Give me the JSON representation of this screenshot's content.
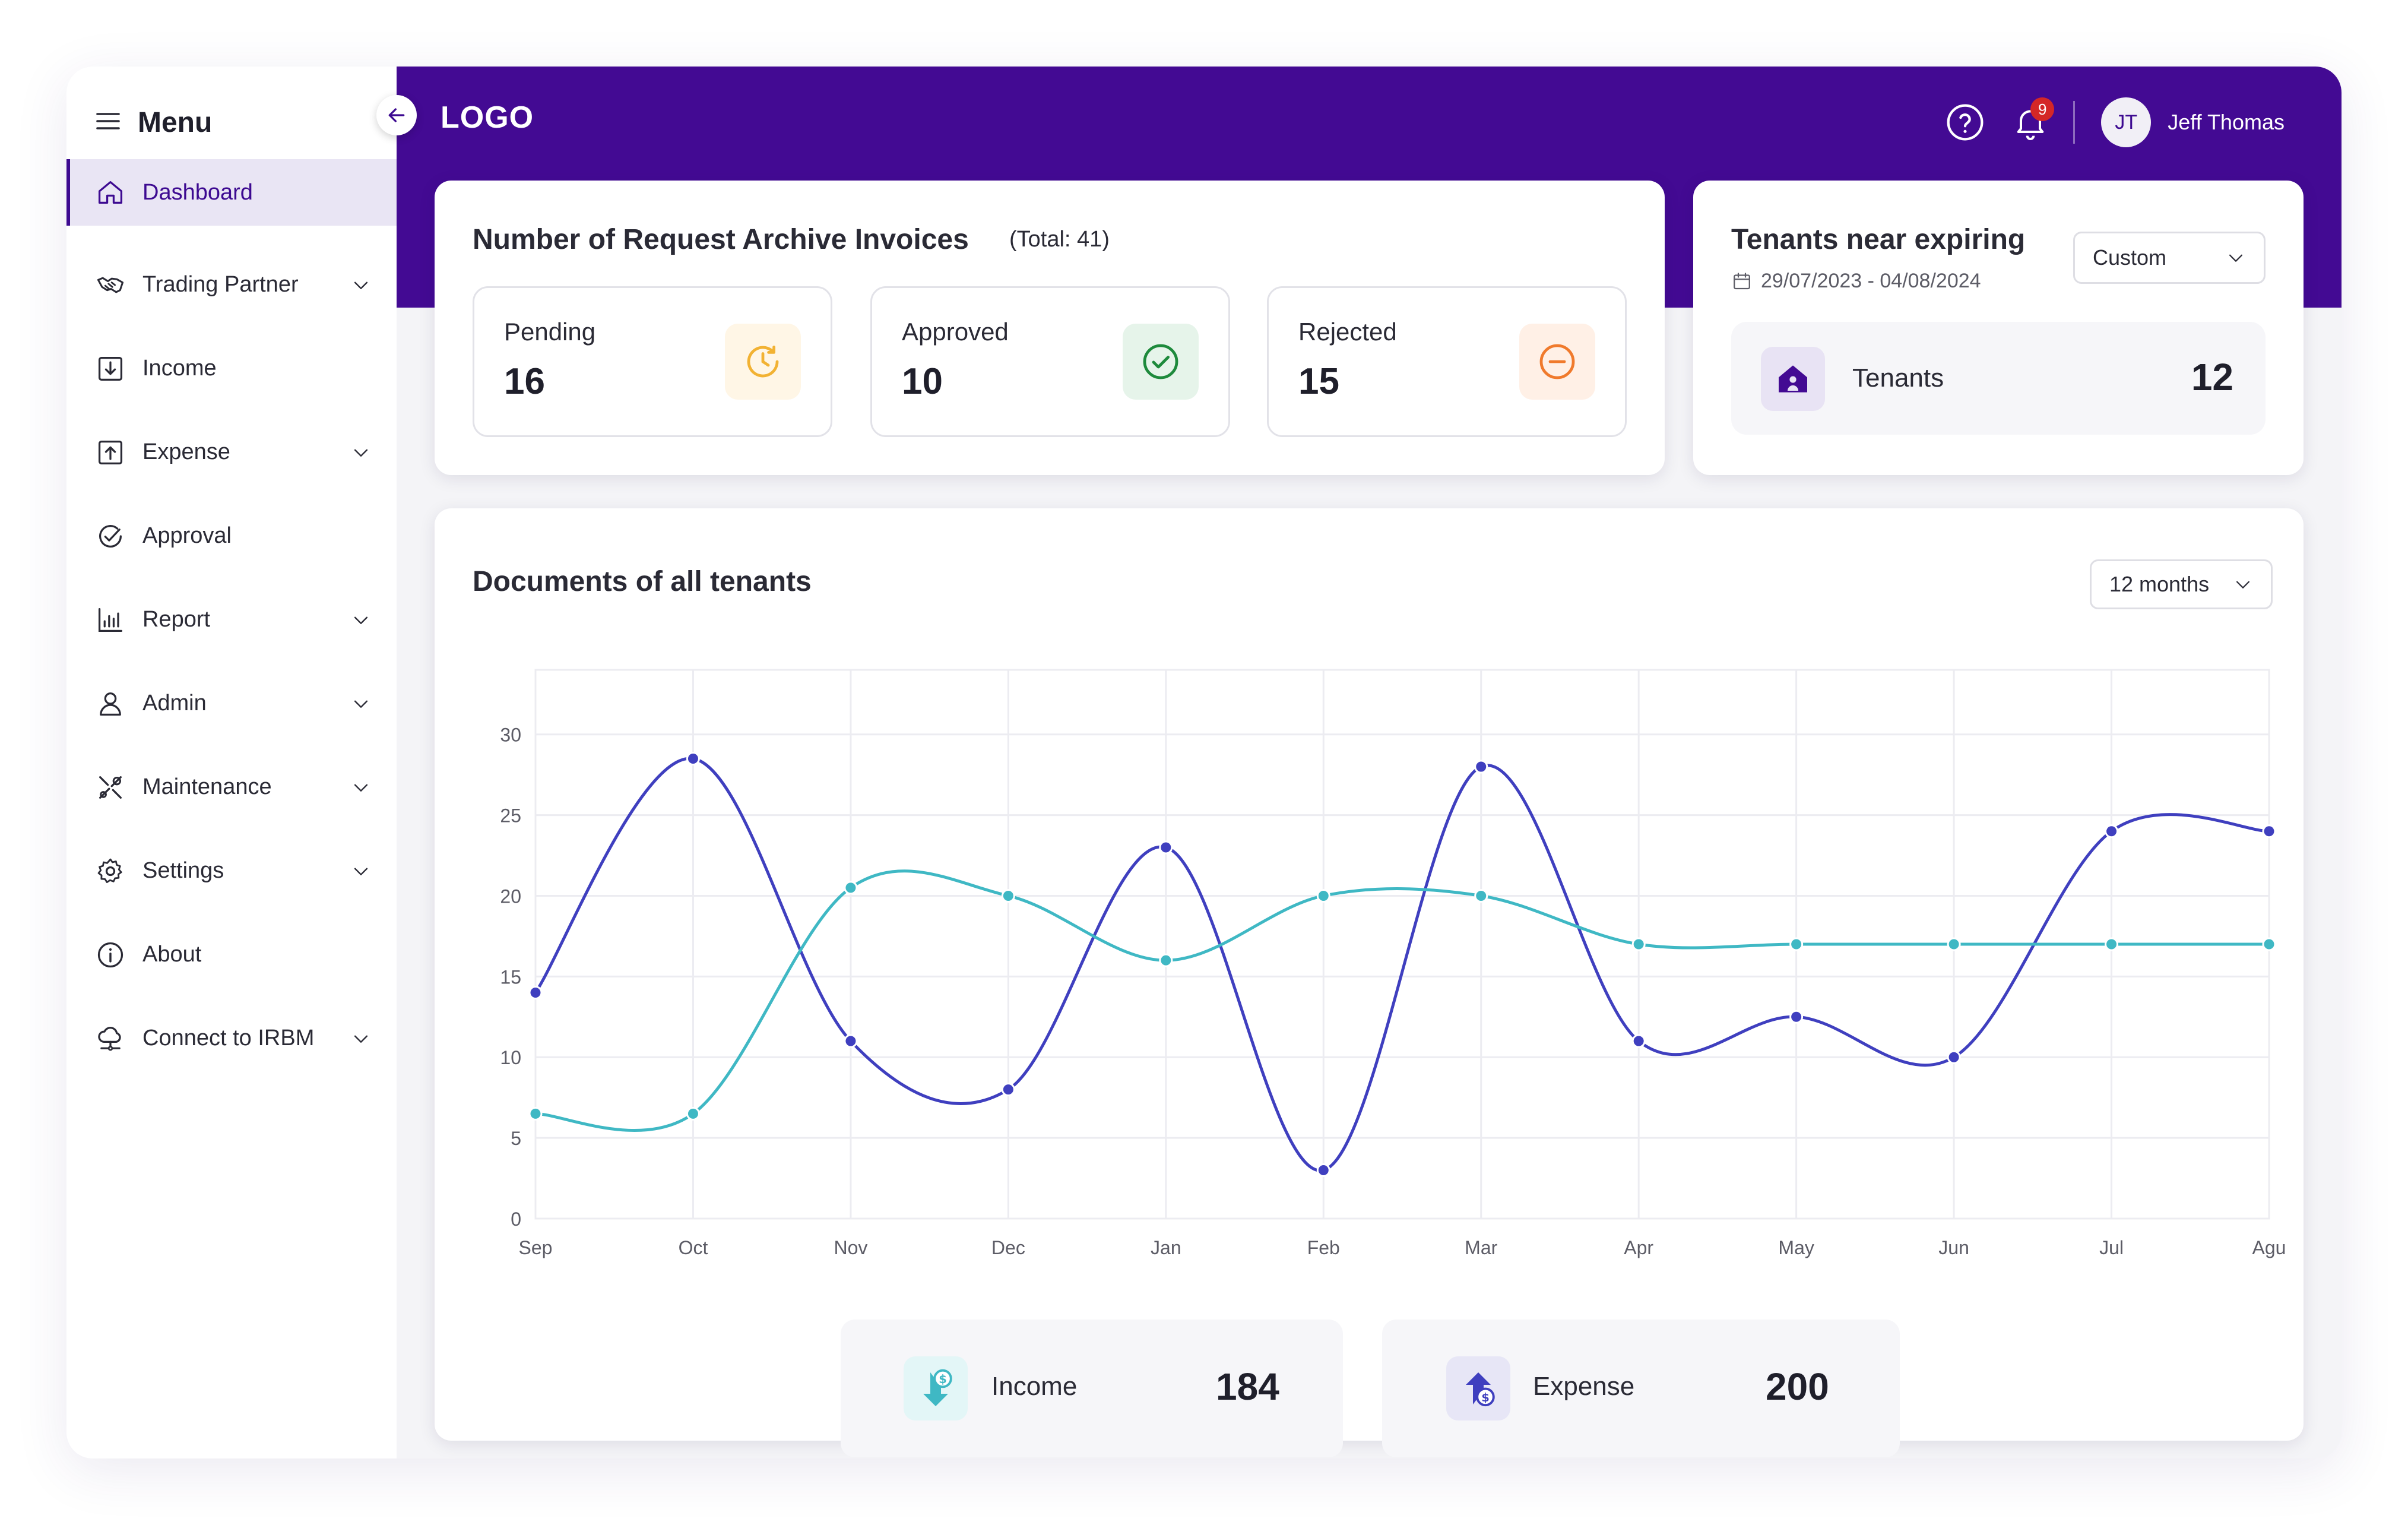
{
  "sidebar": {
    "title": "Menu",
    "items": [
      {
        "label": "Dashboard",
        "icon": "home-icon",
        "active": true,
        "expandable": false
      },
      {
        "label": "Trading Partner",
        "icon": "handshake-icon",
        "active": false,
        "expandable": true
      },
      {
        "label": "Income",
        "icon": "income-icon",
        "active": false,
        "expandable": false
      },
      {
        "label": "Expense",
        "icon": "expense-icon",
        "active": false,
        "expandable": true
      },
      {
        "label": "Approval",
        "icon": "approval-check-icon",
        "active": false,
        "expandable": false
      },
      {
        "label": "Report",
        "icon": "bar-chart-icon",
        "active": false,
        "expandable": true
      },
      {
        "label": "Admin",
        "icon": "user-icon",
        "active": false,
        "expandable": true
      },
      {
        "label": "Maintenance",
        "icon": "tools-icon",
        "active": false,
        "expandable": true
      },
      {
        "label": "Settings",
        "icon": "gear-icon",
        "active": false,
        "expandable": true
      },
      {
        "label": "About",
        "icon": "info-icon",
        "active": false,
        "expandable": false
      },
      {
        "label": "Connect to IRBM",
        "icon": "cloud-connect-icon",
        "active": false,
        "expandable": true
      }
    ]
  },
  "header": {
    "logo": "LOGO",
    "notification_count": "9",
    "user": {
      "initials": "JT",
      "name": "Jeff Thomas"
    }
  },
  "invoices": {
    "title": "Number of Request Archive Invoices",
    "total": "(Total: 41)",
    "stats": [
      {
        "label": "Pending",
        "value": "16",
        "icon": "clock-pending-icon",
        "color": "#f2b233",
        "bg": "#fff6e6"
      },
      {
        "label": "Approved",
        "value": "10",
        "icon": "check-circle-icon",
        "color": "#1e8a3c",
        "bg": "#e6f4ea"
      },
      {
        "label": "Rejected",
        "value": "15",
        "icon": "minus-circle-icon",
        "color": "#f07a2c",
        "bg": "#fff0e6"
      }
    ]
  },
  "tenants": {
    "title": "Tenants near expiring",
    "date_range": "29/07/2023 - 04/08/2024",
    "filter": "Custom",
    "label": "Tenants",
    "value": "12"
  },
  "documents": {
    "title": "Documents of all tenants",
    "filter": "12 months",
    "summary": [
      {
        "label": "Income",
        "value": "184",
        "icon": "income-dollar-icon",
        "bg": "#e3f6f7"
      },
      {
        "label": "Expense",
        "value": "200",
        "icon": "expense-dollar-icon",
        "bg": "#e7e6f6"
      }
    ]
  },
  "chart_data": {
    "type": "line",
    "title": "Documents of all tenants",
    "xlabel": "",
    "ylabel": "",
    "categories": [
      "Sep",
      "Oct",
      "Nov",
      "Dec",
      "Jan",
      "Feb",
      "Mar",
      "Apr",
      "May",
      "Jun",
      "Jul",
      "Agu"
    ],
    "yticks": [
      0,
      5,
      10,
      15,
      20,
      25,
      30
    ],
    "ylim": [
      0,
      34
    ],
    "grid": true,
    "smooth": true,
    "series": [
      {
        "color": "#3f3fbf",
        "values": [
          14,
          28.5,
          11,
          8,
          23,
          3,
          28,
          11,
          12.5,
          10,
          24,
          24
        ]
      },
      {
        "color": "#3fb8c4",
        "values": [
          6.5,
          6.5,
          20.5,
          20,
          16,
          20,
          20,
          17,
          17,
          17,
          17,
          17
        ]
      }
    ]
  },
  "colors": {
    "brand": "#430a93",
    "accent": "#3d0a91",
    "sidebar_active_bg": "#e9e5f4"
  }
}
